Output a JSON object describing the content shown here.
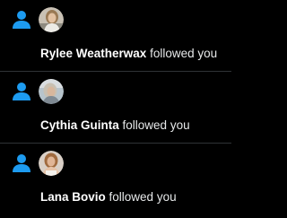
{
  "theme": {
    "background": "#000000",
    "accent": "#1d9bf0",
    "divider": "#2f3336"
  },
  "notifications": [
    {
      "icon": "person-follow-icon",
      "avatar": "user-avatar",
      "user_name": "Rylee Weatherwax",
      "action": "followed you"
    },
    {
      "icon": "person-follow-icon",
      "avatar": "user-avatar",
      "user_name": "Cythia Guinta",
      "action": "followed you"
    },
    {
      "icon": "person-follow-icon",
      "avatar": "user-avatar",
      "user_name": "Lana Bovio",
      "action": "followed you"
    }
  ]
}
